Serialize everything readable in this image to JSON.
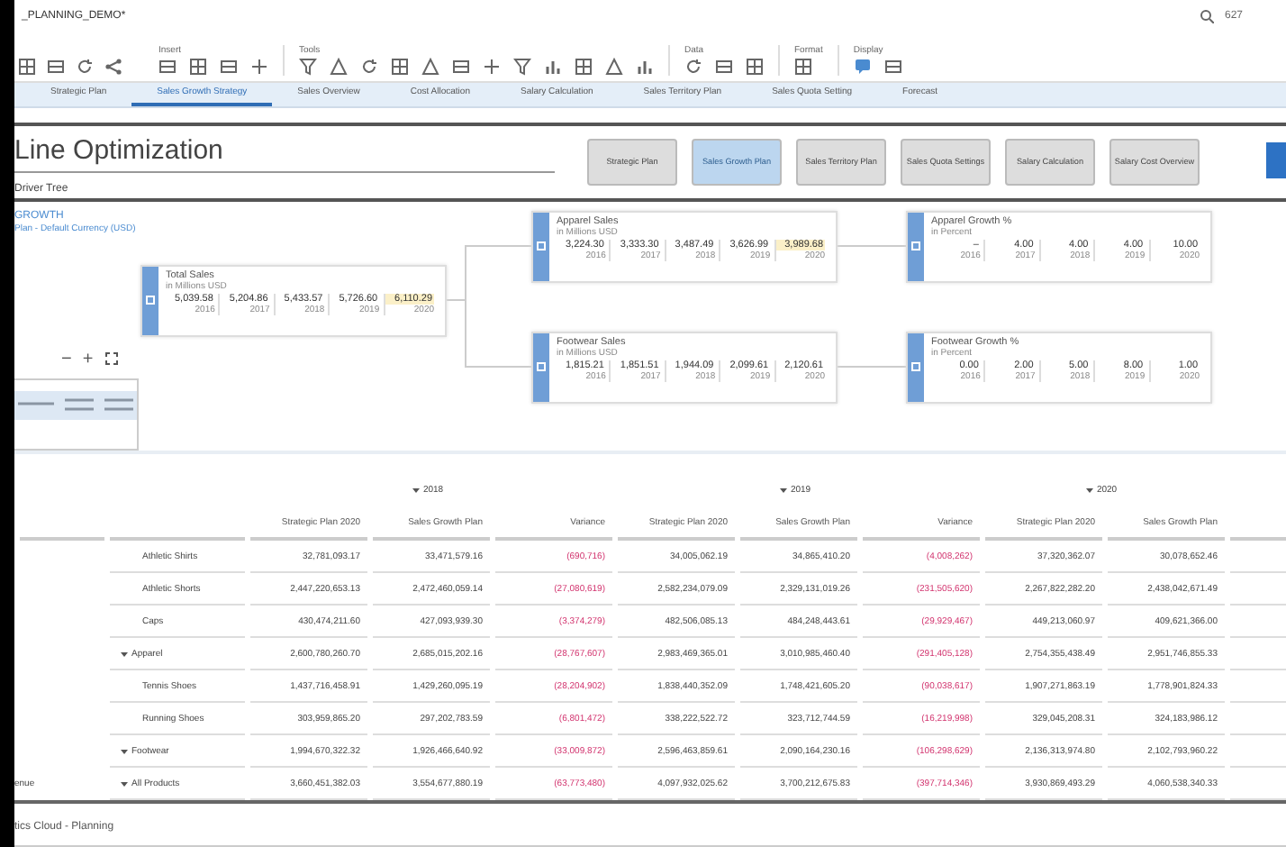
{
  "window": {
    "title": "_PLANNING_DEMO*",
    "search_value": "627"
  },
  "toolbar": {
    "groups": [
      {
        "label": "Insert"
      },
      {
        "label": "Tools"
      },
      {
        "label": "Data"
      },
      {
        "label": "Format"
      },
      {
        "label": "Display"
      }
    ]
  },
  "tabs": [
    {
      "label": "Strategic Plan",
      "selected": false
    },
    {
      "label": "Sales Growth Strategy",
      "selected": true
    },
    {
      "label": "Sales Overview",
      "selected": false
    },
    {
      "label": "Cost Allocation",
      "selected": false
    },
    {
      "label": "Salary Calculation",
      "selected": false
    },
    {
      "label": "Sales Territory Plan",
      "selected": false
    },
    {
      "label": "Sales Quota Setting",
      "selected": false
    },
    {
      "label": "Forecast",
      "selected": false
    }
  ],
  "header": {
    "title": "Line Optimization",
    "subtitle": "Driver Tree"
  },
  "process_steps": [
    {
      "label": "Strategic Plan",
      "selected": false
    },
    {
      "label": "Sales Growth Plan",
      "selected": true
    },
    {
      "label": "Sales Territory Plan",
      "selected": false
    },
    {
      "label": "Sales Quota Settings",
      "selected": false
    },
    {
      "label": "Salary Calculation",
      "selected": false
    },
    {
      "label": "Salary Cost Overview",
      "selected": false
    }
  ],
  "section": {
    "title": "GROWTH",
    "subtitle": "Plan - Default Currency (USD)"
  },
  "zoom_controls": {
    "minus": "−",
    "plus": "+"
  },
  "driver_tree": {
    "nodes": [
      {
        "title": "Total Sales",
        "unit": "in Millions USD",
        "values": [
          {
            "value": "5,039.58",
            "year": "2016",
            "highlighted": false
          },
          {
            "value": "5,204.86",
            "year": "2017",
            "highlighted": false
          },
          {
            "value": "5,433.57",
            "year": "2018",
            "highlighted": false
          },
          {
            "value": "5,726.60",
            "year": "2019",
            "highlighted": false
          },
          {
            "value": "6,110.29",
            "year": "2020",
            "highlighted": true
          }
        ]
      },
      {
        "title": "Apparel Sales",
        "unit": "in Millions USD",
        "values": [
          {
            "value": "3,224.30",
            "year": "2016",
            "highlighted": false
          },
          {
            "value": "3,333.30",
            "year": "2017",
            "highlighted": false
          },
          {
            "value": "3,487.49",
            "year": "2018",
            "highlighted": false
          },
          {
            "value": "3,626.99",
            "year": "2019",
            "highlighted": false
          },
          {
            "value": "3,989.68",
            "year": "2020",
            "highlighted": true
          }
        ]
      },
      {
        "title": "Apparel Growth %",
        "unit": "in Percent",
        "values": [
          {
            "value": "–",
            "year": "2016",
            "highlighted": false
          },
          {
            "value": "4.00",
            "year": "2017",
            "highlighted": false
          },
          {
            "value": "4.00",
            "year": "2018",
            "highlighted": false
          },
          {
            "value": "4.00",
            "year": "2019",
            "highlighted": false
          },
          {
            "value": "10.00",
            "year": "2020",
            "highlighted": false
          }
        ]
      },
      {
        "title": "Footwear Sales",
        "unit": "in Millions USD",
        "values": [
          {
            "value": "1,815.21",
            "year": "2016",
            "highlighted": false
          },
          {
            "value": "1,851.51",
            "year": "2017",
            "highlighted": false
          },
          {
            "value": "1,944.09",
            "year": "2018",
            "highlighted": false
          },
          {
            "value": "2,099.61",
            "year": "2019",
            "highlighted": false
          },
          {
            "value": "2,120.61",
            "year": "2020",
            "highlighted": false
          }
        ]
      },
      {
        "title": "Footwear Growth %",
        "unit": "in Percent",
        "values": [
          {
            "value": "0.00",
            "year": "2016",
            "highlighted": false
          },
          {
            "value": "2.00",
            "year": "2017",
            "highlighted": false
          },
          {
            "value": "5.00",
            "year": "2018",
            "highlighted": false
          },
          {
            "value": "8.00",
            "year": "2019",
            "highlighted": false
          },
          {
            "value": "1.00",
            "year": "2020",
            "highlighted": false
          }
        ]
      }
    ]
  },
  "table": {
    "year_groups": [
      {
        "year": "2018",
        "expanded": true,
        "columns": [
          {
            "label": "Strategic Plan 2020",
            "kind": "plan"
          },
          {
            "label": "Sales Growth Plan",
            "kind": "plan"
          },
          {
            "label": "Variance",
            "kind": "variance"
          }
        ]
      },
      {
        "year": "2019",
        "expanded": true,
        "columns": [
          {
            "label": "Strategic Plan 2020",
            "kind": "plan"
          },
          {
            "label": "Sales Growth Plan",
            "kind": "plan"
          },
          {
            "label": "Variance",
            "kind": "variance"
          }
        ]
      },
      {
        "year": "2020",
        "expanded": true,
        "columns": [
          {
            "label": "Strategic Plan 2020",
            "kind": "plan"
          },
          {
            "label": "Sales Growth Plan",
            "kind": "plan"
          }
        ]
      }
    ],
    "rows": [
      {
        "measure": "enue",
        "label": "All Products",
        "expanded": true,
        "values": [
          "3,660,451,382.03",
          "3,554,677,880.19",
          "(63,773,480)",
          "4,097,932,025.62",
          "3,700,212,675.83",
          "(397,714,346)",
          "3,930,869,493.29",
          "4,060,538,340.33"
        ],
        "children": [
          {
            "label": "Apparel",
            "expanded": true,
            "values": [
              "2,600,780,260.70",
              "2,685,015,202.16",
              "(28,767,607)",
              "2,983,469,365.01",
              "3,010,985,460.40",
              "(291,405,128)",
              "2,754,355,438.49",
              "2,951,746,855.33"
            ],
            "children": [
              {
                "label": "Athletic Shirts",
                "values": [
                  "32,781,093.17",
                  "33,471,579.16",
                  "(690,716)",
                  "34,005,062.19",
                  "34,865,410.20",
                  "(4,008,262)",
                  "37,320,362.07",
                  "30,078,652.46"
                ]
              },
              {
                "label": "Athletic Shorts",
                "values": [
                  "2,447,220,653.13",
                  "2,472,460,059.14",
                  "(27,080,619)",
                  "2,582,234,079.09",
                  "2,329,131,019.26",
                  "(231,505,620)",
                  "2,267,822,282.20",
                  "2,438,042,671.49"
                ]
              },
              {
                "label": "Caps",
                "values": [
                  "430,474,211.60",
                  "427,093,939.30",
                  "(3,374,279)",
                  "482,506,085.13",
                  "484,248,443.61",
                  "(29,929,467)",
                  "449,213,060.97",
                  "409,621,366.00"
                ]
              }
            ]
          },
          {
            "label": "Footwear",
            "expanded": true,
            "values": [
              "1,994,670,322.32",
              "1,926,466,640.92",
              "(33,009,872)",
              "2,596,463,859.61",
              "2,090,164,230.16",
              "(106,298,629)",
              "2,136,313,974.80",
              "2,102,793,960.22"
            ],
            "children": [
              {
                "label": "Tennis Shoes",
                "values": [
                  "1,437,716,458.91",
                  "1,429,260,095.19",
                  "(28,204,902)",
                  "1,838,440,352.09",
                  "1,748,421,605.20",
                  "(90,038,617)",
                  "1,907,271,863.19",
                  "1,778,901,824.33"
                ]
              },
              {
                "label": "Running Shoes",
                "values": [
                  "303,959,865.20",
                  "297,202,783.59",
                  "(6,801,472)",
                  "338,222,522.72",
                  "323,712,744.59",
                  "(16,219,998)",
                  "329,045,208.31",
                  "324,183,986.12"
                ]
              }
            ]
          }
        ]
      }
    ]
  },
  "status_bar": {
    "text": "tics Cloud - Planning"
  }
}
